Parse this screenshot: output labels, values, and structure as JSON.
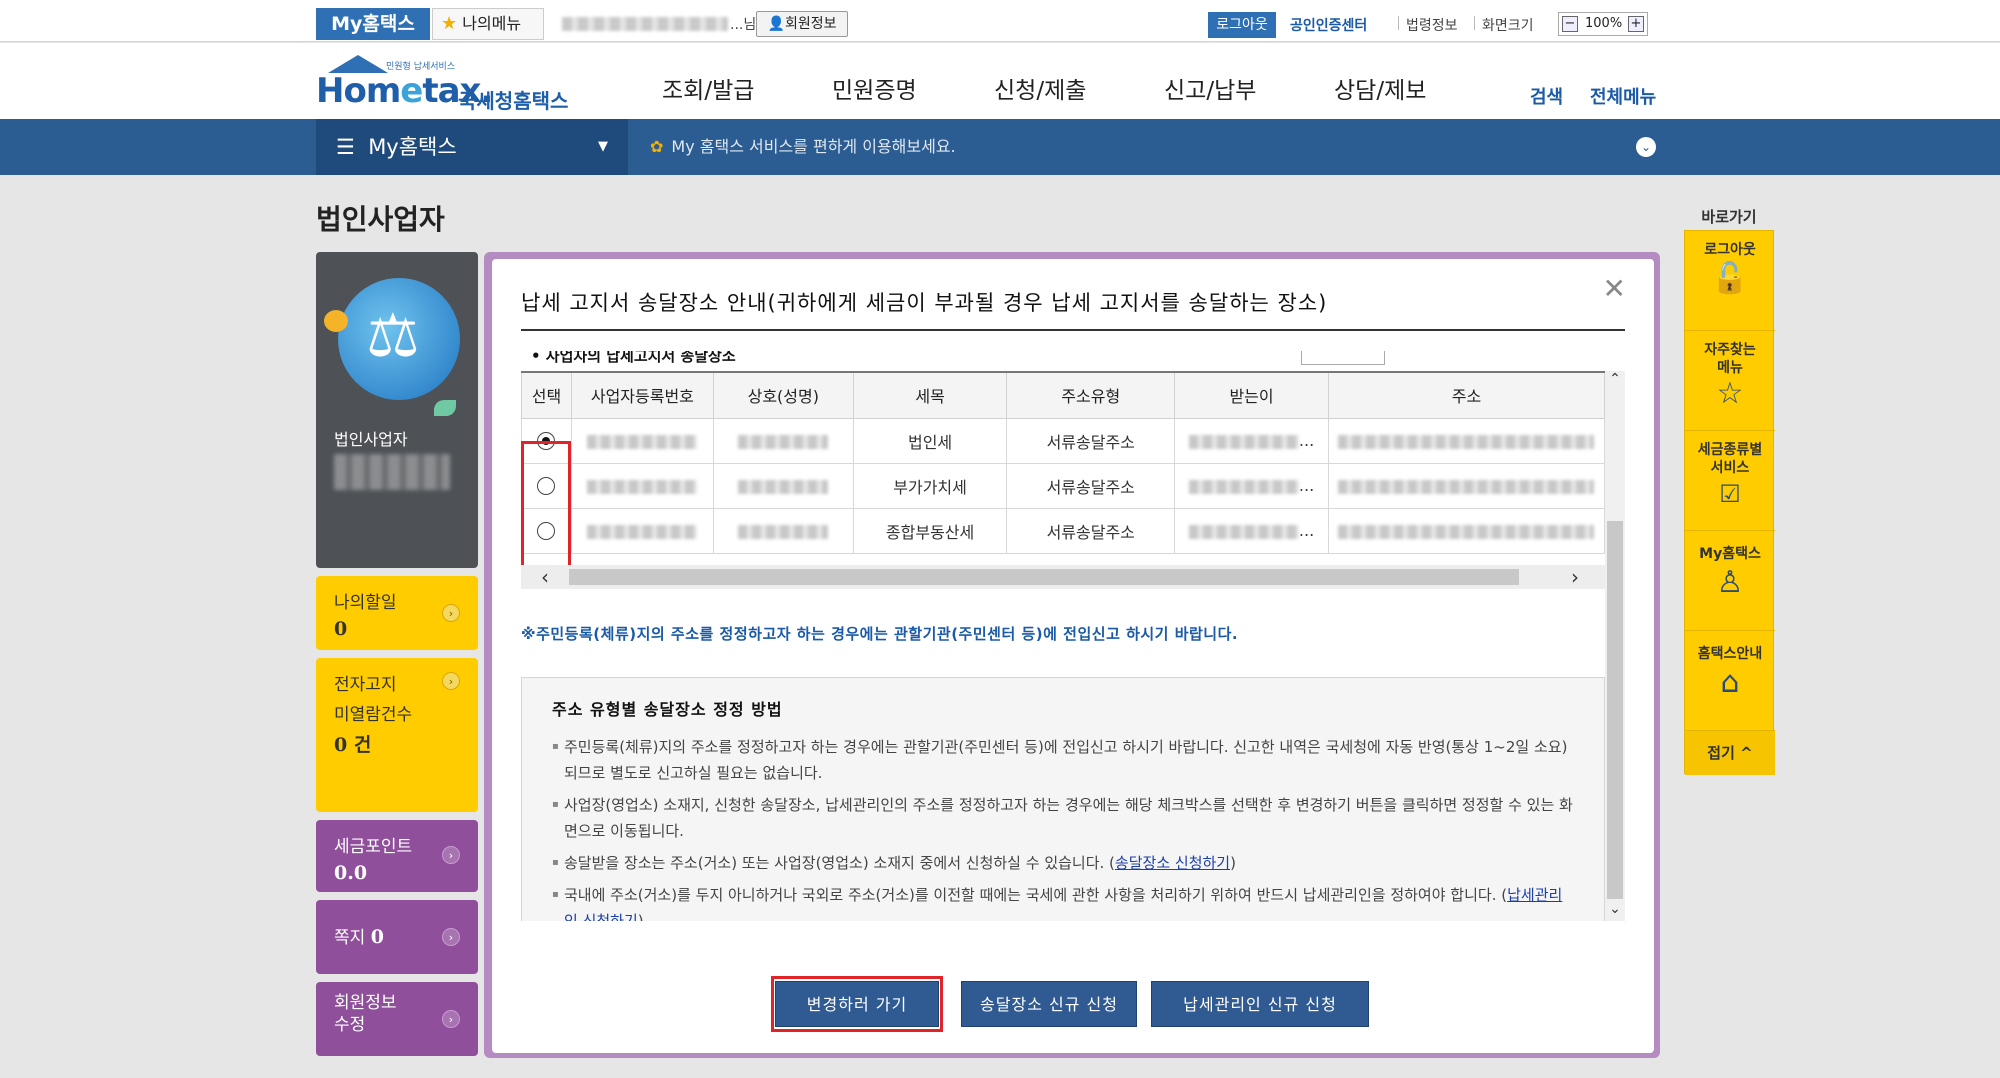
{
  "util": {
    "myhometax": "My홈택스",
    "mymenu": "나의메뉴",
    "user_suffix": "...님",
    "member_info": "회원정보",
    "logout": "로그아웃",
    "cert_center": "공인인증센터",
    "law_info": "법령정보",
    "screen_size": "화면크기",
    "zoom": "100%"
  },
  "header": {
    "logo_tiny": "민원형 납세서비스",
    "logo_main_a": "Hom",
    "logo_main_e": "e",
    "logo_main_b": "tax.",
    "logo_sub": "국세청홈택스",
    "gnb": [
      "조회/발급",
      "민원증명",
      "신청/제출",
      "신고/납부",
      "상담/제보"
    ],
    "search": "검색",
    "all_menu": "전체메뉴"
  },
  "darkbar": {
    "menu": "My홈택스",
    "notice": "My 홈택스 서비스를 편하게 이용해보세요."
  },
  "left": {
    "page_title": "법인사업자",
    "profile_type": "법인사업자",
    "todo_label": "나의할일",
    "todo_count": "0",
    "ebill_label1": "전자고지",
    "ebill_label2": "미열람건수",
    "ebill_count": "0 건",
    "taxpoint_label": "세금포인트",
    "taxpoint_value": "0.0",
    "note_label": "쪽지",
    "note_count": "0",
    "member_edit1": "회원정보",
    "member_edit2": "수정"
  },
  "quick": {
    "title": "바로가기",
    "items": [
      {
        "label": "로그아웃",
        "icon": "lock-icon"
      },
      {
        "label": "자주찾는\n메뉴",
        "icon": "star-icon"
      },
      {
        "label": "세금종류별\n서비스",
        "icon": "check-icon"
      },
      {
        "label": "My홈택스",
        "icon": "person-icon"
      },
      {
        "label": "홈택스안내",
        "icon": "house-icon"
      }
    ],
    "fold": "접기"
  },
  "modal": {
    "title": "납세 고지서 송달장소 안내(귀하에게 세금이 부과될 경우 납세 고지서를 송달하는 장소)",
    "cut_heading": "• 사업자의 납세고지서 송달장소",
    "columns": [
      "선택",
      "사업자등록번호",
      "상호(성명)",
      "세목",
      "주소유형",
      "받는이",
      "주소"
    ],
    "rows": [
      {
        "selected": true,
        "tax": "법인세",
        "addr_type": "서류송달주소",
        "recv_suffix": "..."
      },
      {
        "selected": false,
        "tax": "부가가치세",
        "addr_type": "서류송달주소",
        "recv_suffix": "..."
      },
      {
        "selected": false,
        "tax": "종합부동산세",
        "addr_type": "서류송달주소",
        "recv_suffix": "..."
      }
    ],
    "notice": "※주민등록(체류)지의 주소를 정정하고자 하는 경우에는 관할기관(주민센터 등)에 전입신고 하시기 바랍니다.",
    "guide_title": "주소 유형별 송달장소 정정 방법",
    "guide": [
      {
        "text": "주민등록(체류)지의 주소를 정정하고자 하는 경우에는 관할기관(주민센터 등)에 전입신고 하시기 바랍니다. 신고한 내역은 국세청에 자동 반영(통상 1~2일 소요)되므로 별도로 신고하실 필요는 없습니다.",
        "link": ""
      },
      {
        "text": "사업장(영업소) 소재지, 신청한 송달장소, 납세관리인의 주소를 정정하고자 하는 경우에는 해당 체크박스를 선택한 후 변경하기 버튼을 클릭하면 정정할 수 있는 화면으로 이동됩니다.",
        "link": ""
      },
      {
        "text": "송달받을 장소는 주소(거소) 또는 사업장(영업소) 소재지 중에서 신청하실 수 있습니다. (",
        "link": "송달장소 신청하기",
        "after": ")"
      },
      {
        "text": "국내에 주소(거소)를 두지 아니하거나 국외로 주소(거소)를 이전할 때에는 국세에 관한 사항을 처리하기 위하여 반드시 납세관리인을 정하여야 합니다. (",
        "link": "납세관리인 신청하기",
        "after": ")"
      }
    ],
    "buttons": {
      "change": "변경하러 가기",
      "new_place": "송달장소 신규 신청",
      "new_manager": "납세관리인 신규 신청"
    }
  }
}
